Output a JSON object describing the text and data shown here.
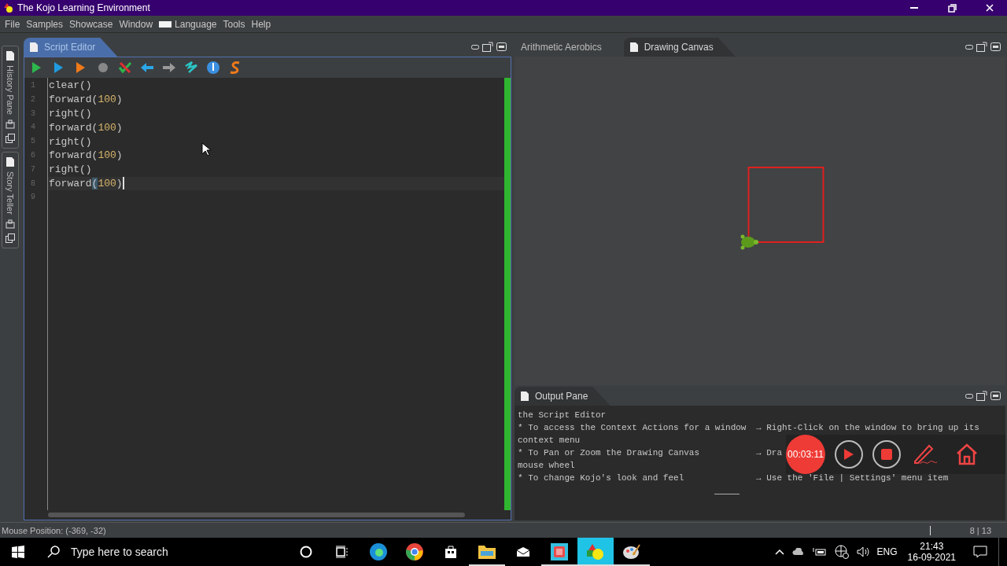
{
  "window": {
    "title": "The Kojo Learning Environment"
  },
  "menu": [
    "File",
    "Samples",
    "Showcase",
    "Window",
    "Language",
    "Tools",
    "Help"
  ],
  "side_tabs": [
    "History Pane",
    "Story Teller"
  ],
  "editor": {
    "title": "Script Editor",
    "lines": [
      {
        "number": "1",
        "current": false,
        "tokens": [
          {
            "text": "clear()",
            "kind": "plain"
          }
        ]
      },
      {
        "number": "2",
        "current": false,
        "tokens": [
          {
            "text": "forward(",
            "kind": "plain"
          },
          {
            "text": "100",
            "kind": "number"
          },
          {
            "text": ")",
            "kind": "plain"
          }
        ]
      },
      {
        "number": "3",
        "current": false,
        "tokens": [
          {
            "text": "right()",
            "kind": "plain"
          }
        ]
      },
      {
        "number": "4",
        "current": false,
        "tokens": [
          {
            "text": "forward(",
            "kind": "plain"
          },
          {
            "text": "100",
            "kind": "number"
          },
          {
            "text": ")",
            "kind": "plain"
          }
        ]
      },
      {
        "number": "5",
        "current": false,
        "tokens": [
          {
            "text": "right()",
            "kind": "plain"
          }
        ]
      },
      {
        "number": "6",
        "current": false,
        "tokens": [
          {
            "text": "forward(",
            "kind": "plain"
          },
          {
            "text": "100",
            "kind": "number"
          },
          {
            "text": ")",
            "kind": "plain"
          }
        ]
      },
      {
        "number": "7",
        "current": false,
        "tokens": [
          {
            "text": "right()",
            "kind": "plain"
          }
        ]
      },
      {
        "number": "8",
        "current": true,
        "tokens": [
          {
            "text": "forward",
            "kind": "plain"
          },
          {
            "text": "(",
            "kind": "match"
          },
          {
            "text": "100",
            "kind": "number"
          },
          {
            "text": ")",
            "kind": "plain"
          }
        ]
      },
      {
        "number": "9",
        "current": false
      }
    ]
  },
  "canvas_tabs": [
    {
      "label": "Arithmetic Aerobics",
      "selected": false
    },
    {
      "label": "Drawing Canvas",
      "selected": true
    }
  ],
  "output": {
    "title": "Output Pane",
    "lines": [
      {
        "left": "the Script Editor"
      },
      {
        "left": "* To access the Context Actions for a window",
        "right": "→ Right-Click on the window to bring up its"
      },
      {
        "left": "context menu"
      },
      {
        "left": "* To Pan or Zoom the Drawing Canvas",
        "right": "→ Dra"
      },
      {
        "left": "mouse wheel"
      },
      {
        "left": "* To change Kojo's look and feel",
        "right": "→ Use the 'File | Settings' menu item"
      }
    ]
  },
  "recorder": {
    "time": "00:03:11"
  },
  "status_bar": {
    "mouse_position": "Mouse Position: (-369, -32)",
    "caret": "8 | 13"
  },
  "taskbar": {
    "search": {
      "placeholder": "Type here to search"
    },
    "apps": [
      {
        "kind": "edge",
        "selected": false,
        "running": false
      },
      {
        "kind": "chrome",
        "selected": false,
        "running": false
      },
      {
        "kind": "store",
        "selected": false,
        "running": false
      },
      {
        "kind": "explorer",
        "selected": false,
        "running": true
      },
      {
        "kind": "mail",
        "selected": false,
        "running": false
      },
      {
        "kind": "recorder",
        "selected": false,
        "running": true
      },
      {
        "kind": "kojo",
        "selected": true,
        "running": true
      },
      {
        "kind": "paint",
        "selected": false,
        "running": true
      }
    ],
    "language": "ENG",
    "time": "21:43",
    "date": "16-09-2021"
  }
}
